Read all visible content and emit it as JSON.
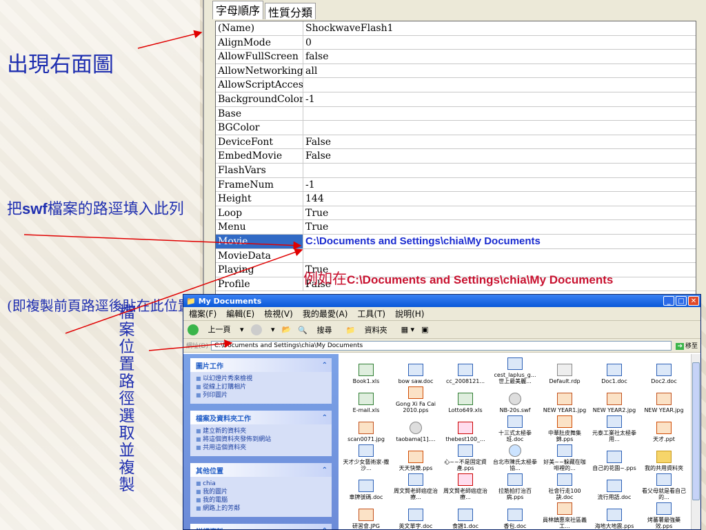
{
  "annotations": {
    "title": "出現右面圖",
    "fill_path_prefix": "把",
    "fill_path_bold": "swf",
    "fill_path_suffix": "檔案的路逕填入此列",
    "paste_note": "(即複製前頁路逕後貼在此位置)",
    "vertical_note": "檔案位置路徑選取並複製",
    "example_prefix": "例如在",
    "example_path": "C:\\Documents and Settings\\chia\\My Documents"
  },
  "properties": {
    "tabs": [
      "字母順序",
      "性質分類"
    ],
    "rows": [
      {
        "name": "(Name)",
        "value": "ShockwaveFlash1"
      },
      {
        "name": "AlignMode",
        "value": "0"
      },
      {
        "name": "AllowFullScreen",
        "value": "false"
      },
      {
        "name": "AllowNetworking",
        "value": "all"
      },
      {
        "name": "AllowScriptAccess",
        "value": ""
      },
      {
        "name": "BackgroundColor",
        "value": "-1"
      },
      {
        "name": "Base",
        "value": ""
      },
      {
        "name": "BGColor",
        "value": ""
      },
      {
        "name": "DeviceFont",
        "value": "False"
      },
      {
        "name": "EmbedMovie",
        "value": "False"
      },
      {
        "name": "FlashVars",
        "value": ""
      },
      {
        "name": "FrameNum",
        "value": "-1"
      },
      {
        "name": "Height",
        "value": "144"
      },
      {
        "name": "Loop",
        "value": "True"
      },
      {
        "name": "Menu",
        "value": "True"
      },
      {
        "name": "Movie",
        "value": "C:\\Documents and Settings\\chia\\My Documents"
      },
      {
        "name": "MovieData",
        "value": ""
      },
      {
        "name": "Playing",
        "value": "True"
      },
      {
        "name": "Profile",
        "value": "False"
      }
    ]
  },
  "explorer": {
    "title": "My Documents",
    "menu": [
      "檔案(F)",
      "編輯(E)",
      "檢視(V)",
      "我的最愛(A)",
      "工具(T)",
      "說明(H)"
    ],
    "toolbar": {
      "back": "上一頁",
      "search": "搜尋",
      "folders": "資料夾"
    },
    "address_label": "網址(D)",
    "address": "C:\\Documents and Settings\\chia\\My Documents",
    "go": "移至",
    "panels": [
      {
        "title": "圖片工作",
        "items": [
          "以幻燈片秀來檢視",
          "從線上訂購相片",
          "列印圖片"
        ]
      },
      {
        "title": "檔案及資料夾工作",
        "items": [
          "建立新的資料夾",
          "將這個資料夾發佈到網站",
          "共用這個資料夾"
        ]
      },
      {
        "title": "其他位置",
        "items": [
          "chia",
          "我的圖片",
          "我的電腦",
          "網路上的芳鄰"
        ]
      },
      {
        "title": "詳細資料",
        "items": []
      }
    ],
    "files": [
      {
        "name": "Book1.xls",
        "type": "xls"
      },
      {
        "name": "bow saw.doc",
        "type": "doc"
      },
      {
        "name": "cc_2008121...",
        "type": "doc"
      },
      {
        "name": "cest_laplus_g... 世上最美麗...",
        "type": "doc"
      },
      {
        "name": "Default.rdp",
        "type": "rdp"
      },
      {
        "name": "Doc1.doc",
        "type": "doc"
      },
      {
        "name": "Doc2.doc",
        "type": "doc"
      },
      {
        "name": "E-mail.xls",
        "type": "xls"
      },
      {
        "name": "Gong Xi Fa Cai 2010.pps",
        "type": "pps"
      },
      {
        "name": "Lotto649.xls",
        "type": "xls"
      },
      {
        "name": "NB-20s.swf",
        "type": "swf"
      },
      {
        "name": "NEW YEAR1.jpg",
        "type": "jpg"
      },
      {
        "name": "NEW YEAR2.jpg",
        "type": "jpg"
      },
      {
        "name": "NEW YEAR.jpg",
        "type": "jpg"
      },
      {
        "name": "scan0071.jpg",
        "type": "jpg"
      },
      {
        "name": "taobama[1]....",
        "type": "swf"
      },
      {
        "name": "thebest100_...",
        "type": "pdf"
      },
      {
        "name": "十三式太極拳班.doc",
        "type": "doc"
      },
      {
        "name": "中華肚皮舞集錦.pps",
        "type": "pps"
      },
      {
        "name": "元泰工業社太極拳用...",
        "type": "doc"
      },
      {
        "name": "天才.ppt",
        "type": "pps"
      },
      {
        "name": "天才少女藝術家-撒沙...",
        "type": "doc"
      },
      {
        "name": "天天快樂.pps",
        "type": "pps"
      },
      {
        "name": "心~~不是固定資產.pps",
        "type": "doc"
      },
      {
        "name": "台北市陳氏太極拳協...",
        "type": "url"
      },
      {
        "name": "好美~~躲藏在咖啡裡的...",
        "type": "doc"
      },
      {
        "name": "自己的花園~.pps",
        "type": "doc"
      },
      {
        "name": "我的共用資料夾",
        "type": "folder"
      },
      {
        "name": "車牌號碼.doc",
        "type": "doc"
      },
      {
        "name": "周文賢老師癌症治療...",
        "type": "doc"
      },
      {
        "name": "周文賢老師癌症治療...",
        "type": "pdf"
      },
      {
        "name": "拉筋拍打治百病.pps",
        "type": "doc"
      },
      {
        "name": "社會行走100訣.doc",
        "type": "doc"
      },
      {
        "name": "流行用語.doc",
        "type": "doc"
      },
      {
        "name": "看父母就是看自己的...",
        "type": "doc"
      },
      {
        "name": "研習會.JPG",
        "type": "jpg"
      },
      {
        "name": "英文單字.doc",
        "type": "doc"
      },
      {
        "name": "食譜1.doc",
        "type": "doc"
      },
      {
        "name": "香包.doc",
        "type": "doc"
      },
      {
        "name": "員林鎮惠來社區義工...",
        "type": "jpg"
      },
      {
        "name": "海地大地震.pps",
        "type": "doc"
      },
      {
        "name": "烤蕃薯最強藥效.pps",
        "type": "doc"
      }
    ]
  },
  "colors": {
    "annotation": "#1f2fb0",
    "example": "#c8102e",
    "selected": "#316ac5",
    "arrow": "#e00000"
  }
}
